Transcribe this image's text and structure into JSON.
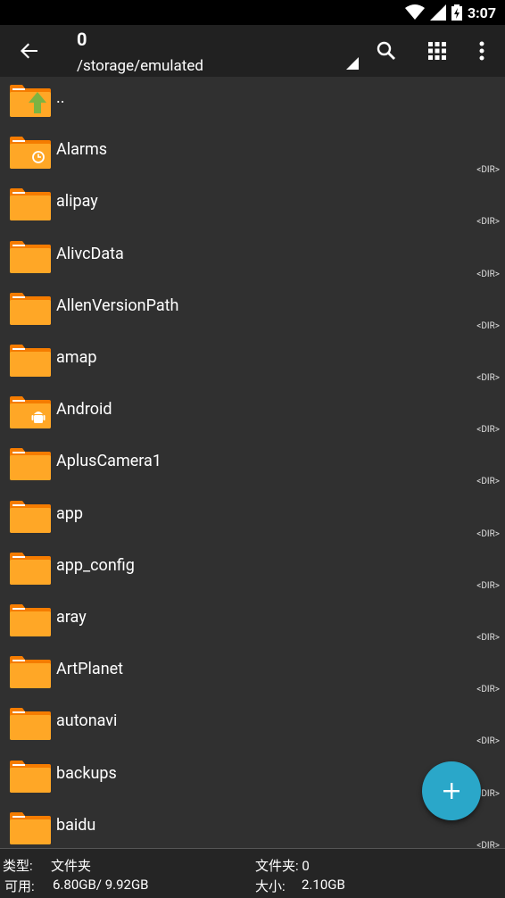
{
  "status": {
    "time": "3:07"
  },
  "toolbar": {
    "title": "0",
    "path": "/storage/emulated"
  },
  "parent_label": "..",
  "dir_tag": "<DIR>",
  "files": [
    {
      "name": "Alarms",
      "icon": "alarm-folder"
    },
    {
      "name": "alipay",
      "icon": "folder"
    },
    {
      "name": "AlivcData",
      "icon": "folder"
    },
    {
      "name": "AllenVersionPath",
      "icon": "folder"
    },
    {
      "name": "amap",
      "icon": "folder"
    },
    {
      "name": "Android",
      "icon": "android-folder"
    },
    {
      "name": "AplusCamera1",
      "icon": "folder"
    },
    {
      "name": "app",
      "icon": "folder"
    },
    {
      "name": "app_config",
      "icon": "folder"
    },
    {
      "name": "aray",
      "icon": "folder"
    },
    {
      "name": "ArtPlanet",
      "icon": "folder"
    },
    {
      "name": "autonavi",
      "icon": "folder"
    },
    {
      "name": "backups",
      "icon": "folder"
    },
    {
      "name": "baidu",
      "icon": "folder"
    }
  ],
  "footer": {
    "type_label": "类型:",
    "type_value": "文件夹",
    "folder_count": "文件夹: 0",
    "free_label": "可用:",
    "free_value": "6.80GB/ 9.92GB",
    "size_label": "大小:",
    "size_value": "2.10GB"
  },
  "colors": {
    "folder": "#ffa726",
    "folder_dark": "#f57c00",
    "fab": "#2aa7c9",
    "up_arrow": "#7cb342"
  }
}
